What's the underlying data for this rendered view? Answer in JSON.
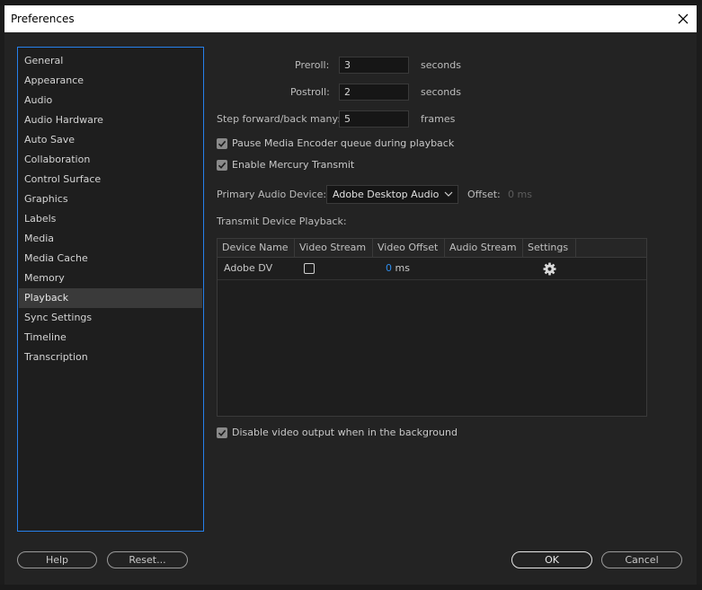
{
  "window": {
    "title": "Preferences"
  },
  "sidebar": {
    "items": [
      {
        "label": "General"
      },
      {
        "label": "Appearance"
      },
      {
        "label": "Audio"
      },
      {
        "label": "Audio Hardware"
      },
      {
        "label": "Auto Save"
      },
      {
        "label": "Collaboration"
      },
      {
        "label": "Control Surface"
      },
      {
        "label": "Graphics"
      },
      {
        "label": "Labels"
      },
      {
        "label": "Media"
      },
      {
        "label": "Media Cache"
      },
      {
        "label": "Memory"
      },
      {
        "label": "Playback"
      },
      {
        "label": "Sync Settings"
      },
      {
        "label": "Timeline"
      },
      {
        "label": "Transcription"
      }
    ],
    "selected": "Playback"
  },
  "playback": {
    "preroll": {
      "label": "Preroll:",
      "value": "3",
      "unit": "seconds"
    },
    "postroll": {
      "label": "Postroll:",
      "value": "2",
      "unit": "seconds"
    },
    "step": {
      "label": "Step forward/back many:",
      "value": "5",
      "unit": "frames"
    },
    "pause_media_encoder": {
      "label": "Pause Media Encoder queue during playback",
      "checked": true
    },
    "enable_mercury": {
      "label": "Enable Mercury Transmit",
      "checked": true
    },
    "primary_audio": {
      "label": "Primary Audio Device:",
      "value": "Adobe Desktop Audio"
    },
    "offset": {
      "label": "Offset:",
      "value": "0 ms"
    },
    "transmit_label": "Transmit Device Playback:",
    "table": {
      "columns": [
        "Device Name",
        "Video Stream",
        "Video Offset",
        "Audio Stream",
        "Settings"
      ],
      "rows": [
        {
          "device": "Adobe DV",
          "video_stream": false,
          "offset_value": "0",
          "offset_unit": "ms"
        }
      ]
    },
    "disable_background": {
      "label": "Disable video output when in the background",
      "checked": true
    }
  },
  "buttons": {
    "help": "Help",
    "reset": "Reset...",
    "ok": "OK",
    "cancel": "Cancel"
  },
  "colors": {
    "accent": "#2680eb",
    "link_blue": "#2d8ceb"
  },
  "icons": {
    "close": "close-icon",
    "check": "checkmark-icon",
    "chevron": "chevron-down-icon",
    "gear": "gear-icon"
  }
}
